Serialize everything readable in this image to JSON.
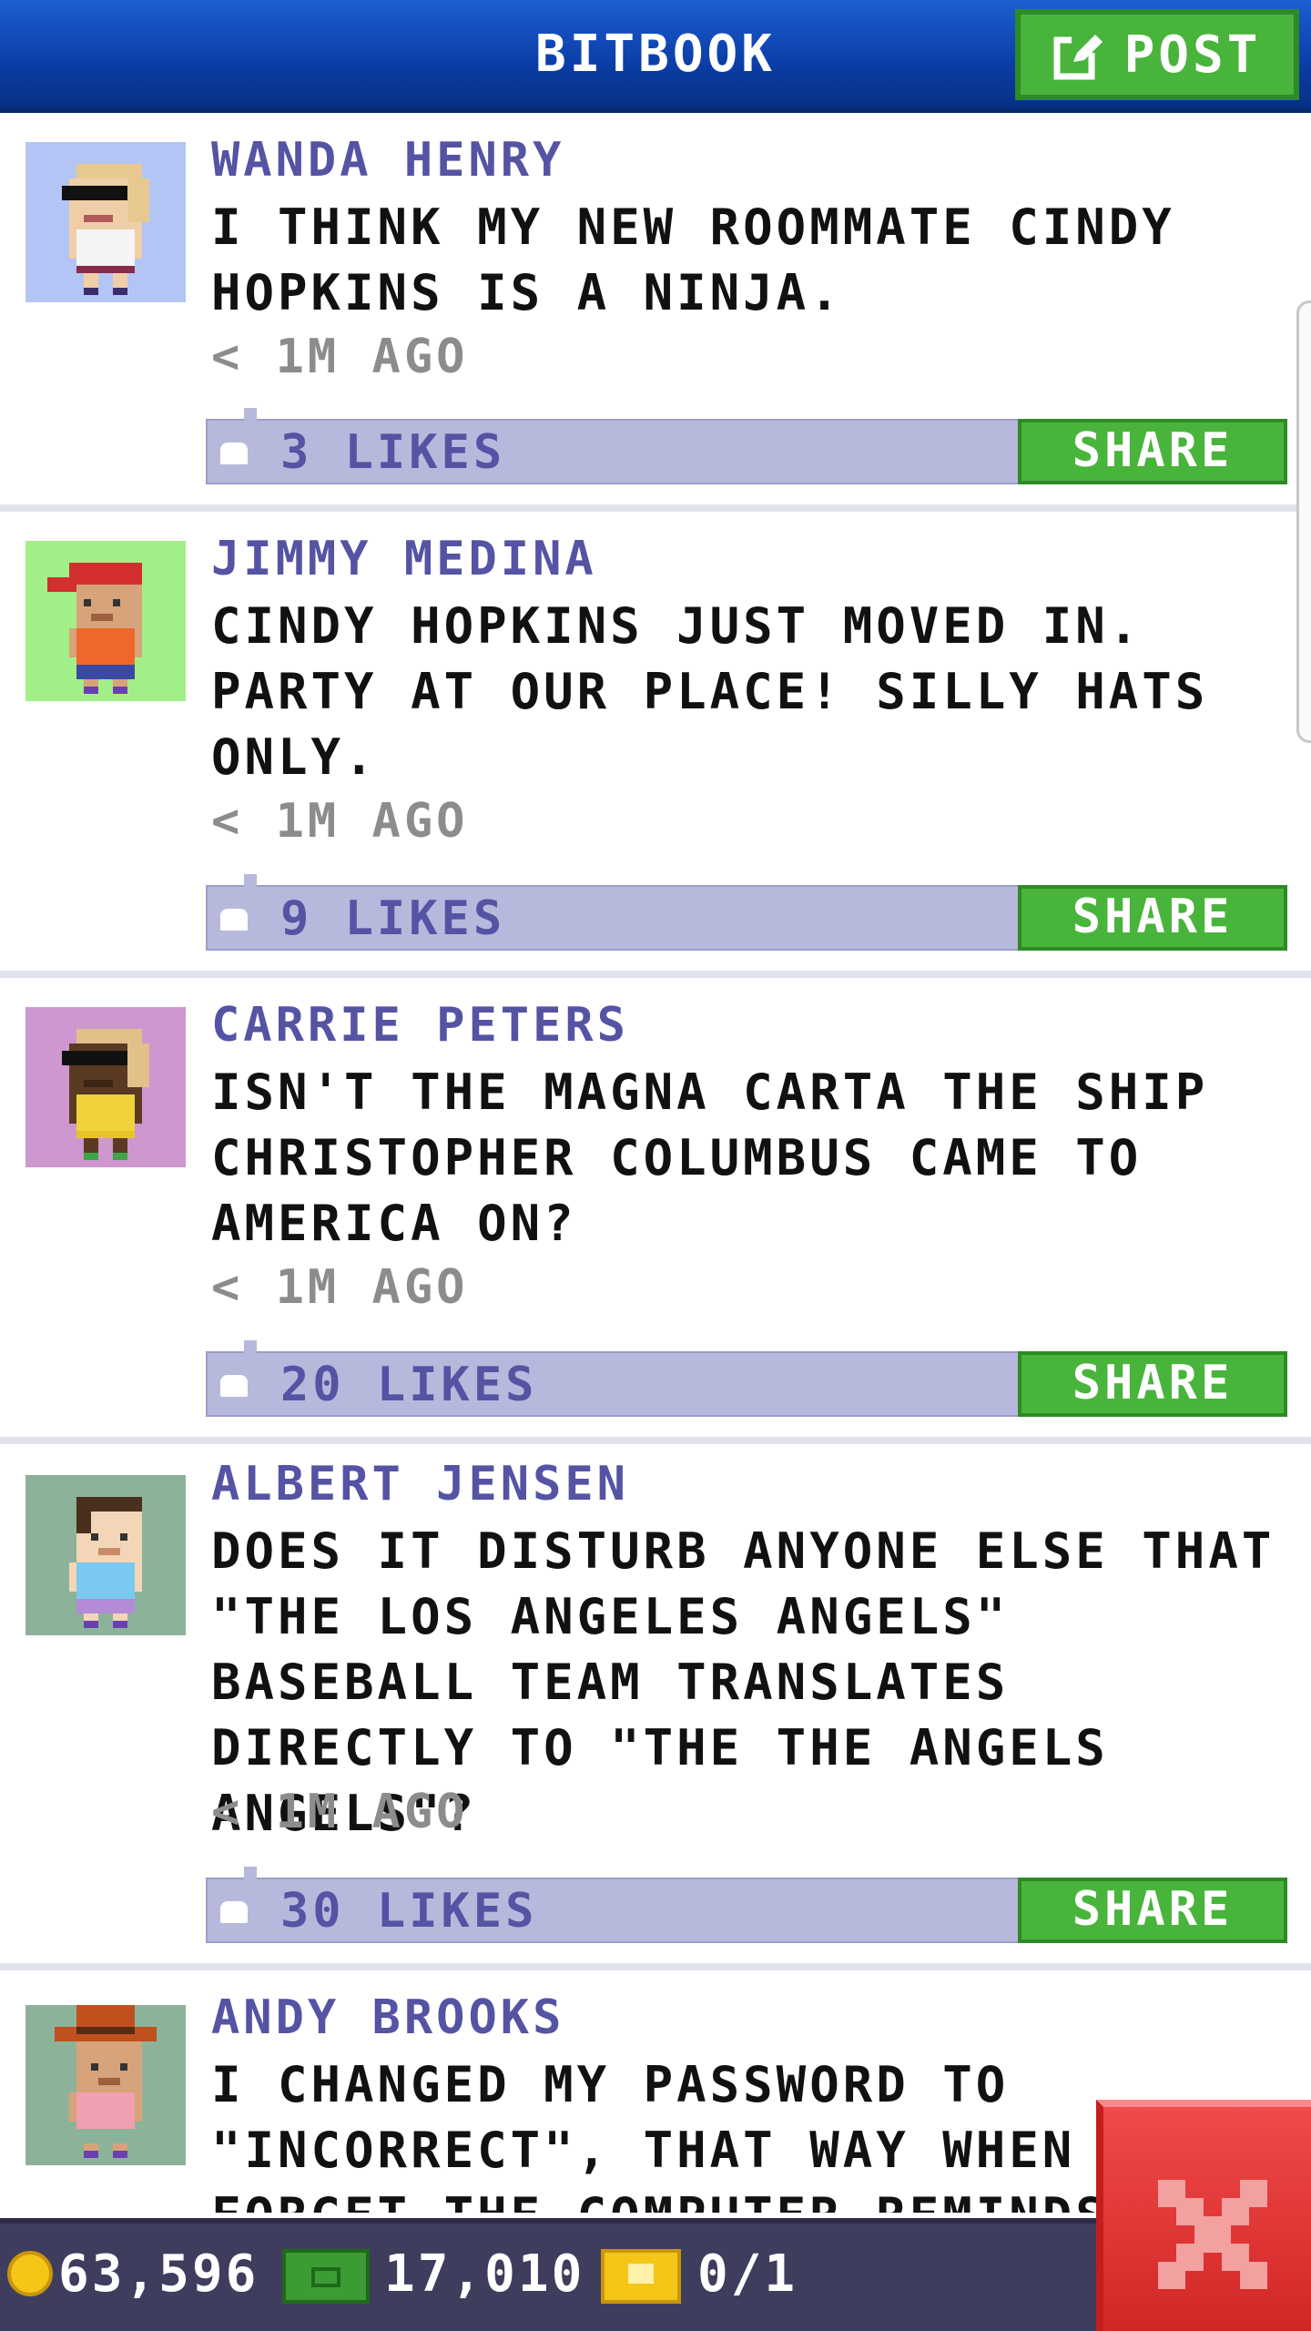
{
  "header": {
    "title": "BITBOOK",
    "post_label": "POST"
  },
  "posts": [
    {
      "name": "WANDA HENRY",
      "message": "I THINK MY NEW ROOMMATE CINDY HOPKINS IS A NINJA.",
      "time": "< 1M AGO",
      "likes": "3 LIKES",
      "share": "SHARE",
      "avatar_bg": "#b3c5f4"
    },
    {
      "name": "JIMMY MEDINA",
      "message": "CINDY HOPKINS JUST MOVED IN. PARTY AT OUR PLACE! SILLY HATS ONLY.",
      "time": "< 1M AGO",
      "likes": "9 LIKES",
      "share": "SHARE",
      "avatar_bg": "#a3ef87"
    },
    {
      "name": "CARRIE PETERS",
      "message": "ISN'T THE MAGNA CARTA THE SHIP CHRISTOPHER COLUMBUS CAME TO AMERICA ON?",
      "time": "< 1M AGO",
      "likes": "20 LIKES",
      "share": "SHARE",
      "avatar_bg": "#cf97cf"
    },
    {
      "name": "ALBERT JENSEN",
      "message": "DOES IT DISTURB ANYONE ELSE THAT \"THE LOS ANGELES ANGELS\" BASEBALL TEAM TRANSLATES DIRECTLY TO \"THE THE ANGELS ANGELS\"?",
      "time": "< 1M AGO",
      "likes": "30 LIKES",
      "share": "SHARE",
      "avatar_bg": "#8cb39a"
    },
    {
      "name": "ANDY BROOKS",
      "message": "I CHANGED MY PASSWORD TO \"INCORRECT\", THAT WAY WHEN I FORGET THE COMPUTER REMINDS",
      "avatar_bg": "#8cb39a"
    }
  ],
  "status_bar": {
    "coins": "63,596",
    "cash": "17,010",
    "tickets": "0/1"
  },
  "colors": {
    "header_blue": "#0b3da6",
    "button_green": "#49b43b",
    "likes_bar": "#b7b9dc",
    "name_purple": "#5553a3",
    "close_red": "#d22626"
  },
  "icons": [
    "edit-icon",
    "like-icon",
    "coin-icon",
    "cash-icon",
    "ticket-icon",
    "close-icon"
  ]
}
